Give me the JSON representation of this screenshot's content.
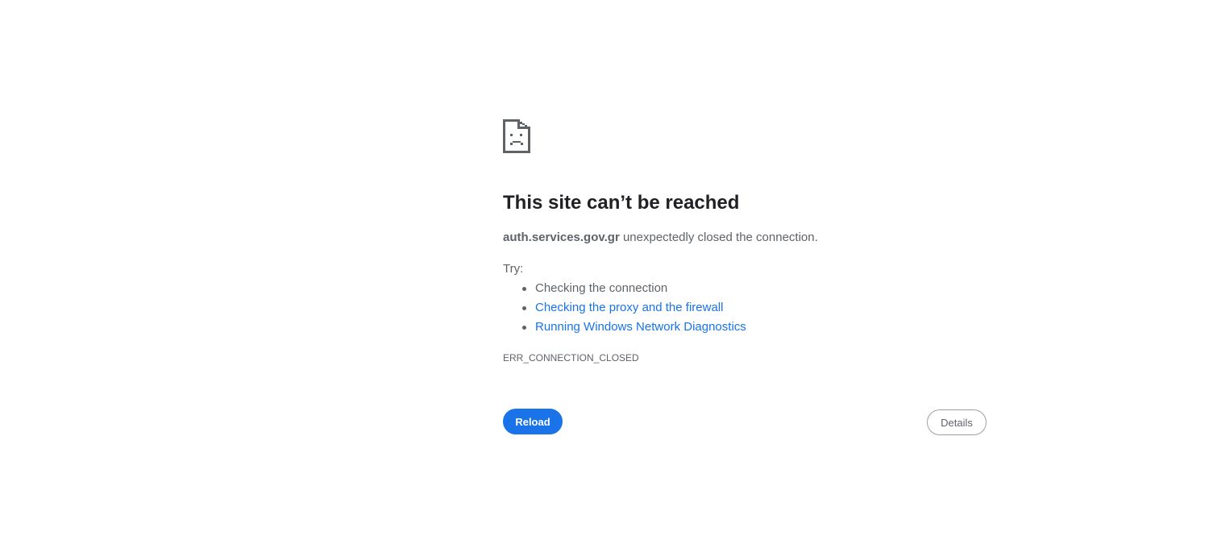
{
  "error_page": {
    "icon": "sad-document-icon",
    "heading": "This site can’t be reached",
    "host": "auth.services.gov.gr",
    "summary_rest": " unexpectedly closed the connection.",
    "try_label": "Try:",
    "suggestions": [
      {
        "text": "Checking the connection",
        "is_link": false
      },
      {
        "text": "Checking the proxy and the firewall",
        "is_link": true
      },
      {
        "text": "Running Windows Network Diagnostics",
        "is_link": true
      }
    ],
    "error_code": "ERR_CONNECTION_CLOSED",
    "reload_label": "Reload",
    "details_label": "Details"
  },
  "colors": {
    "accent": "#1a73e8",
    "heading": "#202124",
    "text": "#5f6368"
  }
}
